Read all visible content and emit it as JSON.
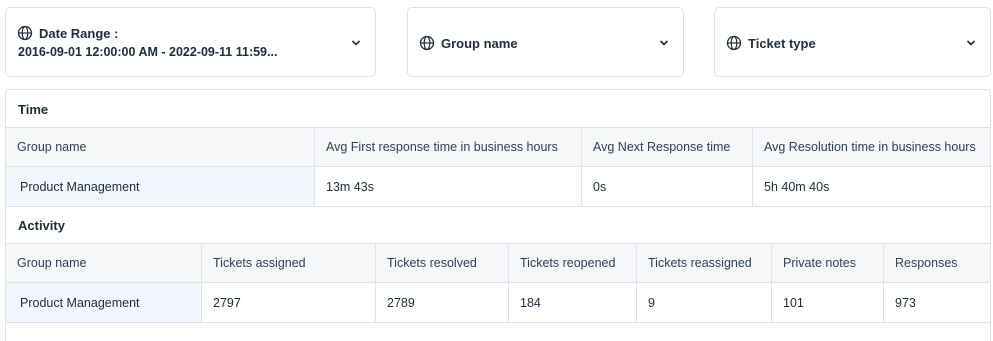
{
  "filters": {
    "date_range": {
      "label": "Date Range :",
      "value": "2016-09-01 12:00:00 AM - 2022-09-11 11:59...",
      "icon": "globe-icon"
    },
    "group_name": {
      "label": "Group name",
      "icon": "globe-icon"
    },
    "ticket_type": {
      "label": "Ticket type",
      "icon": "globe-icon"
    }
  },
  "time_section": {
    "title": "Time",
    "columns": [
      "Group name",
      "Avg First response time in business hours",
      "Avg Next Response time",
      "Avg Resolution time in business hours"
    ],
    "rows": [
      [
        "Product Management",
        "13m 43s",
        "0s",
        "5h 40m 40s"
      ]
    ]
  },
  "activity_section": {
    "title": "Activity",
    "columns": [
      "Group name",
      "Tickets assigned",
      "Tickets resolved",
      "Tickets reopened",
      "Tickets reassigned",
      "Private notes",
      "Responses"
    ],
    "rows": [
      [
        "Product Management",
        "2797",
        "2789",
        "184",
        "9",
        "101",
        "973"
      ]
    ]
  },
  "colors": {
    "text": "#1f2d3d",
    "border": "#dfe3e8",
    "header_bg": "#f5f7f9",
    "first_cell_bg": "#f2f7fd"
  }
}
